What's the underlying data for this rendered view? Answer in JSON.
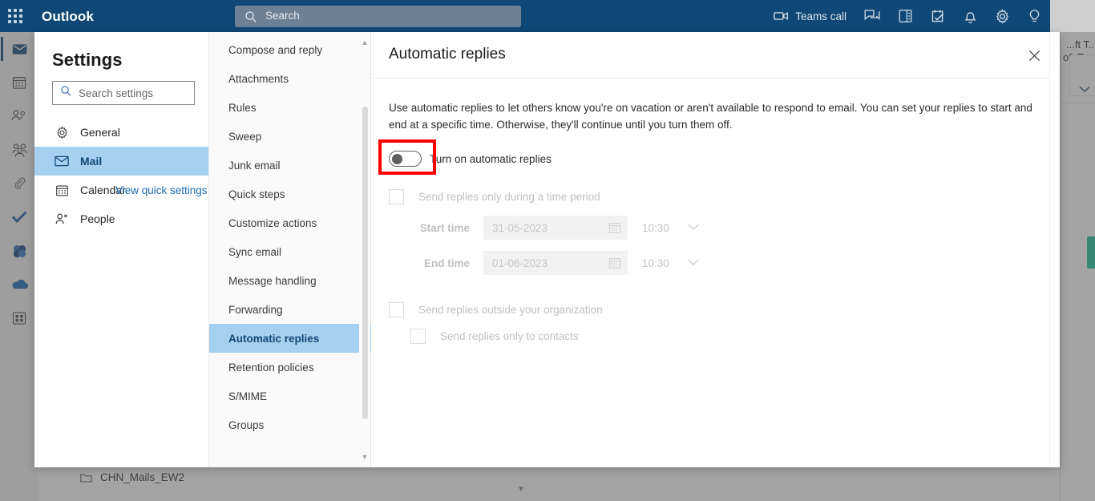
{
  "topbar": {
    "waffle_icon": "app-launcher-icon",
    "brand": "Outlook",
    "search_placeholder": "Search",
    "search_icon": "search-icon",
    "items": [
      {
        "icon": "video-camera-icon",
        "label": "Teams call"
      },
      {
        "icon": "chat-icon",
        "label": ""
      },
      {
        "icon": "contact-card-icon",
        "label": ""
      },
      {
        "icon": "tasks-icon",
        "label": ""
      },
      {
        "icon": "bell-icon",
        "label": ""
      },
      {
        "icon": "gear-icon",
        "label": ""
      },
      {
        "icon": "lightbulb-icon",
        "label": ""
      }
    ]
  },
  "rail": {
    "items": [
      {
        "icon": "mail-icon",
        "selected": true
      },
      {
        "icon": "calendar-icon",
        "selected": false
      },
      {
        "icon": "people-icon",
        "selected": false
      },
      {
        "icon": "groups-icon",
        "selected": false
      },
      {
        "icon": "attachment-icon",
        "selected": false
      },
      {
        "icon": "todo-check-icon",
        "selected": false
      },
      {
        "icon": "teams-flower-icon",
        "selected": false
      },
      {
        "icon": "onedrive-cloud-icon",
        "selected": false
      },
      {
        "icon": "apps-grid-icon",
        "selected": false
      }
    ]
  },
  "background": {
    "folder_icon": "folder-icon",
    "folder_name": "CHN_Mails_EW2",
    "right_text_1": "...ft T...",
    "right_text_2": "oft T...",
    "chevron_icon": "chevron-down-icon",
    "scroll_arrow_icon": "triangle-down-icon"
  },
  "settings": {
    "title": "Settings",
    "search_placeholder": "Search settings",
    "search_icon": "search-icon",
    "nav_items": [
      {
        "label": "General",
        "icon": "gear-icon",
        "active": false
      },
      {
        "label": "Mail",
        "icon": "mail-icon",
        "active": true
      },
      {
        "label": "Calendar",
        "icon": "calendar-icon",
        "active": false
      },
      {
        "label": "People",
        "icon": "person-icon",
        "active": false
      }
    ],
    "quick_settings_link": "View quick settings",
    "categories": [
      {
        "label": "Compose and reply",
        "active": false
      },
      {
        "label": "Attachments",
        "active": false
      },
      {
        "label": "Rules",
        "active": false
      },
      {
        "label": "Sweep",
        "active": false
      },
      {
        "label": "Junk email",
        "active": false
      },
      {
        "label": "Quick steps",
        "active": false
      },
      {
        "label": "Customize actions",
        "active": false
      },
      {
        "label": "Sync email",
        "active": false
      },
      {
        "label": "Message handling",
        "active": false
      },
      {
        "label": "Forwarding",
        "active": false
      },
      {
        "label": "Automatic replies",
        "active": true
      },
      {
        "label": "Retention policies",
        "active": false
      },
      {
        "label": "S/MIME",
        "active": false
      },
      {
        "label": "Groups",
        "active": false
      }
    ],
    "scroll_up_icon": "triangle-up-icon",
    "scroll_down_icon": "triangle-down-icon"
  },
  "panel": {
    "title": "Automatic replies",
    "close_icon": "close-icon",
    "description": "Use automatic replies to let others know you're on vacation or aren't available to respond to email. You can set your replies to start and end at a specific time. Otherwise, they'll continue until you turn them off.",
    "toggle": {
      "label": "Turn on automatic replies",
      "state": "off",
      "highlight_color": "#fe0000"
    },
    "time_period_checkbox": {
      "label": "Send replies only during a time period",
      "checked": false,
      "disabled": true
    },
    "start_time": {
      "label": "Start time",
      "date": "31-05-2023",
      "time": "10:30",
      "calendar_icon": "calendar-icon",
      "chevron_icon": "chevron-down-icon"
    },
    "end_time": {
      "label": "End time",
      "date": "01-06-2023",
      "time": "10:30",
      "calendar_icon": "calendar-icon",
      "chevron_icon": "chevron-down-icon"
    },
    "outside_org_checkbox": {
      "label": "Send replies outside your organization",
      "checked": false,
      "disabled": true
    },
    "contacts_only_checkbox": {
      "label": "Send replies only to contacts",
      "checked": false,
      "disabled": true
    }
  },
  "colors": {
    "topbar": "#0f4877",
    "accent": "#0f4877",
    "selection": "#a6d0f0",
    "link": "#1a6bb5",
    "annotation": "#fe0000"
  }
}
